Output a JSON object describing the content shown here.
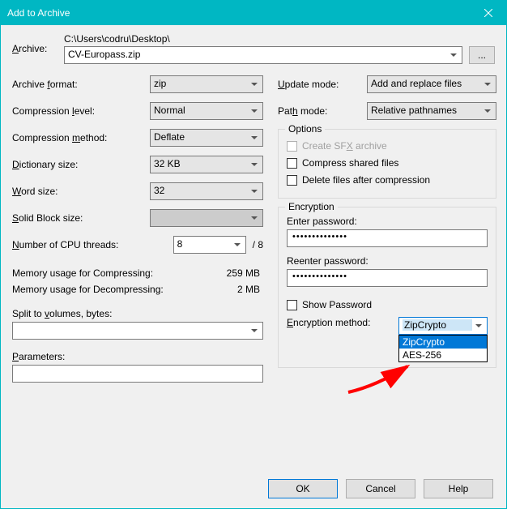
{
  "window": {
    "title": "Add to Archive"
  },
  "archive": {
    "label": "Archive:",
    "path": "C:\\Users\\codru\\Desktop\\",
    "filename": "CV-Europass.zip",
    "browse": "..."
  },
  "left": {
    "format_label": "Archive format:",
    "format_value": "zip",
    "level_label": "Compression level:",
    "level_value": "Normal",
    "method_label": "Compression method:",
    "method_value": "Deflate",
    "dict_label": "Dictionary size:",
    "dict_value": "32 KB",
    "word_label": "Word size:",
    "word_value": "32",
    "solid_label": "Solid Block size:",
    "solid_value": "",
    "threads_label": "Number of CPU threads:",
    "threads_value": "8",
    "threads_total": "/ 8",
    "mem_comp_label": "Memory usage for Compressing:",
    "mem_comp_value": "259 MB",
    "mem_decomp_label": "Memory usage for Decompressing:",
    "mem_decomp_value": "2 MB",
    "split_label": "Split to volumes, bytes:",
    "split_value": "",
    "param_label": "Parameters:",
    "param_value": ""
  },
  "right": {
    "update_label": "Update mode:",
    "update_value": "Add and replace files",
    "pathmode_label": "Path mode:",
    "pathmode_value": "Relative pathnames",
    "options_legend": "Options",
    "opt_sfx": "Create SFX archive",
    "opt_shared": "Compress shared files",
    "opt_delete": "Delete files after compression",
    "enc_legend": "Encryption",
    "enter_pw_label": "Enter password:",
    "reenter_pw_label": "Reenter password:",
    "pw_mask": "••••••••••••••",
    "show_pw": "Show Password",
    "enc_method_label": "Encryption method:",
    "enc_method_value": "ZipCrypto",
    "enc_options": [
      "ZipCrypto",
      "AES-256"
    ]
  },
  "buttons": {
    "ok": "OK",
    "cancel": "Cancel",
    "help": "Help"
  }
}
